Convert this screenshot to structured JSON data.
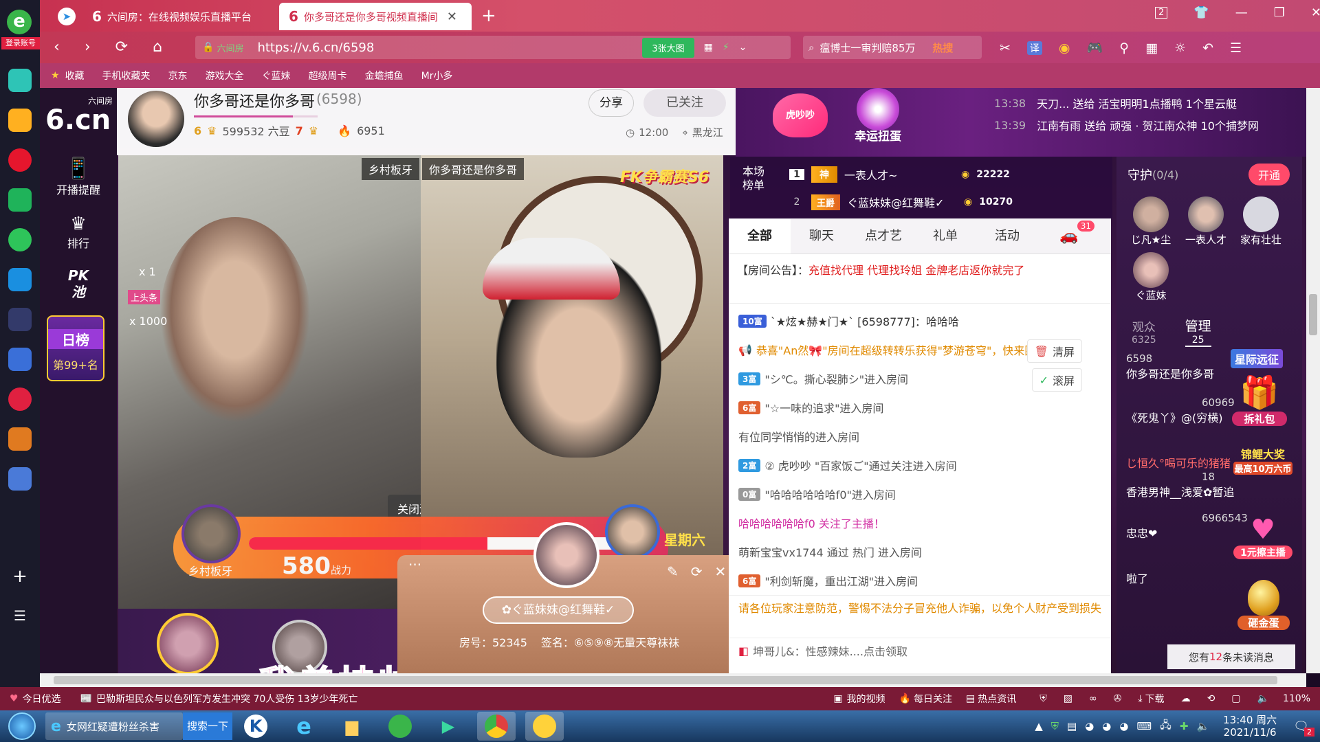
{
  "browser": {
    "login_label": "登录账号",
    "tabs": [
      {
        "title": "六间房：在线视频娱乐直播平台"
      },
      {
        "title": "你多哥还是你多哥视频直播间"
      }
    ],
    "tab_count": "2",
    "url": "https://v.6.cn/6598",
    "site_label": "六间房",
    "big_image_btn": "3张大图",
    "search_text": "瘟博士一审判赔85万",
    "search_hot": "热搜",
    "translate": "译",
    "bookmarks": [
      "收藏",
      "手机收藏夹",
      "京东",
      "游戏大全",
      "ぐ蓝妹",
      "超级周卡",
      "金蟾捕鱼",
      "Mr小多"
    ]
  },
  "sidebar": {
    "logo_text": "6.cn",
    "logo_sub": "六间房",
    "items": [
      {
        "label": "开播提醒",
        "icon": "phone-icon"
      },
      {
        "label": "排行",
        "icon": "crown-icon"
      },
      {
        "label": "PK池",
        "icon": "pk-icon"
      }
    ],
    "rank_title": "日榜",
    "rank_value": "第99+名"
  },
  "room": {
    "host_name": "你多哥还是你多哥",
    "room_id": "(6598)",
    "level_left": "6",
    "beans": "599532 六豆",
    "level_right": "7",
    "fans": "6951",
    "share_label": "分享",
    "follow_label": "已关注",
    "time": "12:00",
    "location": "黑龙江"
  },
  "events": {
    "gift_badge": "虎吵吵",
    "lucky_label": "幸运扭蛋",
    "gift_feed": [
      {
        "time": "13:38",
        "text": "天刀... 送给 活宝明明1点播鸭 1个星云艇"
      },
      {
        "time": "13:39",
        "text": "江南有雨 送给 顽强 · 贺江南众神 10个捕梦网"
      }
    ]
  },
  "ranking": {
    "title": "本场榜单",
    "rows": [
      {
        "rank": "1",
        "tag": "神",
        "name": "一表人才~",
        "score": "22222"
      },
      {
        "rank": "2",
        "tag": "王爵",
        "name": "ぐ蓝妹妹@红舞鞋✓",
        "score": "10270"
      }
    ]
  },
  "videos": {
    "left_name": "乡村板牙",
    "right_name": "你多哥还是你多哥",
    "pk_label": "FK争霸赛S6",
    "gift_counts": [
      "x 1",
      "x 1000"
    ],
    "gift_tag": "上头条",
    "close_game": "关闭游戏",
    "score_player": "乡村板牙",
    "score_value": "580",
    "score_unit": "战力",
    "weekday_badge": "星期六",
    "subtitle": "我曾挂帅  匹马纵横"
  },
  "popup": {
    "name": "✿ぐ蓝妹妹@红舞鞋✓",
    "room_no": "房号：52345",
    "sign": "签名：⑥⑤⑨⑧无量天尊袜袜"
  },
  "chat": {
    "tabs": [
      "全部",
      "聊天",
      "点才艺",
      "礼单",
      "活动"
    ],
    "car_count": "31",
    "notice_label": "【房间公告】：",
    "notice_text": "充值找代理 代理找玲姐 金牌老店返你就完了",
    "clear_btn": "清屏",
    "scroll_btn": "滚屏",
    "rows": [
      {
        "badge": "10富",
        "badge_color": "#3a5fd8",
        "text": "`★炫★赫★门★` [6598777]：哈哈哈"
      },
      {
        "badge": "",
        "badge_color": "",
        "text": "恭喜\"An然🎀\"房间在超级转转乐获得\"梦游苍穹\"，快来围观吧"
      },
      {
        "badge": "3富",
        "badge_color": "#2f9ae0",
        "text": "\"シ℃。撕心裂肺シ\"进入房间"
      },
      {
        "badge": "6富",
        "badge_color": "#e06030",
        "text": "\"☆一味的追求\"进入房间"
      },
      {
        "badge": "",
        "badge_color": "",
        "text": "有位同学悄悄的进入房间"
      },
      {
        "badge": "2富",
        "badge_color": "#2f9ae0",
        "text": "② 虎吵吵 \"百家饭ご\"通过关注进入房间"
      },
      {
        "badge": "0富",
        "badge_color": "#999999",
        "text": "\"哈哈哈哈哈哈f0\"进入房间"
      },
      {
        "badge": "",
        "badge_color": "",
        "text": "哈哈哈哈哈哈f0 关注了主播！"
      },
      {
        "badge": "",
        "badge_color": "",
        "text": "萌新宝宝vx1744 通过 热门 进入房间"
      },
      {
        "badge": "6富",
        "badge_color": "#e06030",
        "text": "\"利剑斩魔，重出江湖\"进入房间"
      }
    ],
    "warning": "请各位玩家注意防范，警惕不法分子冒充他人诈骗，以免个人财产受到损失",
    "bottom_msg": "坤哥儿&：性感辣妹....点击领取"
  },
  "guard": {
    "title": "守护",
    "count": "(0/4)",
    "open_btn": "开通",
    "members": [
      "じ凡★尘",
      "一表人才",
      "家有壮壮",
      "ぐ蓝妹"
    ],
    "tab_viewers": "观众",
    "viewers_count": "6325",
    "tab_admin": "管理",
    "admin_count": "25",
    "star_label": "星际远征",
    "unbox_label": "拆礼包",
    "koi_label": "锦鲤大奖",
    "koi_amount": "最高10万六币",
    "one_yuan_label": "1元擦主播",
    "egg_label": "砸金蛋",
    "users": [
      {
        "level": "6598",
        "name": "你多哥还是你多哥"
      },
      {
        "level": "60969",
        "name": "《死鬼丫》@(穷横)"
      },
      {
        "level": "",
        "name": "じ恒久°喝可乐的猪猪"
      },
      {
        "level": "18",
        "name": "香港男神__浅爱✿暂追"
      },
      {
        "level": "6966543",
        "name": "忠忠❤"
      },
      {
        "level": "",
        "name": "啦了"
      }
    ],
    "unread_prefix": "您有",
    "unread_count": "12",
    "unread_suffix": "条未读消息"
  },
  "statusbar": {
    "today": "今日优选",
    "news": "巴勒斯坦民众与以色列军方发生冲突 70人受伤 13岁少年死亡",
    "items": [
      "我的视频",
      "每日关注",
      "热点资讯",
      "下载"
    ],
    "zoom": "110%"
  },
  "taskbar": {
    "task_title": "女网红疑遭粉丝杀害",
    "search_btn": "搜索一下",
    "time": "13:40 周六",
    "date": "2021/11/6",
    "notify_count": "2"
  },
  "colors": {
    "accent": "#d0304e",
    "warning_text": "#e08a00",
    "notice_red": "#e02020"
  }
}
